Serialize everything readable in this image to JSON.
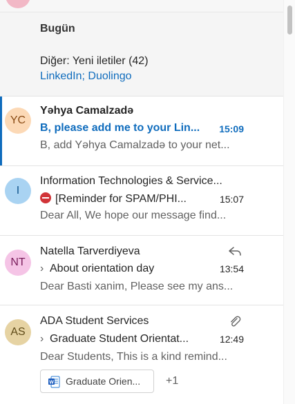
{
  "sections": {
    "today_label": "Bugün",
    "other_title": "Diğer: Yeni iletiler (42)",
    "other_senders": "LinkedIn; Duolingo"
  },
  "emails": [
    {
      "initials": "YC",
      "avatar_color": "#fcd9b6",
      "avatar_text_color": "#8a4b14",
      "sender": "Yəhya Camalzadə",
      "subject": "B, please add me to your Lin...",
      "time": "15:09",
      "preview": "B, add Yəhya Camalzadə to your net...",
      "unread": true
    },
    {
      "initials": "I",
      "avatar_color": "#a9d3f2",
      "avatar_text_color": "#0f548c",
      "sender": "Information Technologies & Service...",
      "subject": "[Reminder for SPAM/PHI...",
      "time": "15:07",
      "preview": "Dear All, We hope our message find...",
      "icon": "blocked-icon"
    },
    {
      "initials": "NT",
      "avatar_color": "#f5c4e6",
      "avatar_text_color": "#7a1d5c",
      "sender": "Natella Tarverdiyeva",
      "subject": "About orientation day",
      "time": "13:54",
      "preview": "Dear Basti xanim, Please see my ans...",
      "icon": "reply-icon"
    },
    {
      "initials": "AS",
      "avatar_color": "#e6d3a3",
      "avatar_text_color": "#5e4a17",
      "sender": "ADA Student Services",
      "subject": "Graduate Student Orientat...",
      "time": "12:49",
      "preview": "Dear Students, This is a kind remind...",
      "icon": "paperclip-icon",
      "attachment": "Graduate Orien...",
      "more_attachments": "+1"
    }
  ],
  "colors": {
    "accent": "#0f6cbd",
    "unread_accent": "#0f6cbd",
    "muted": "#616161"
  }
}
